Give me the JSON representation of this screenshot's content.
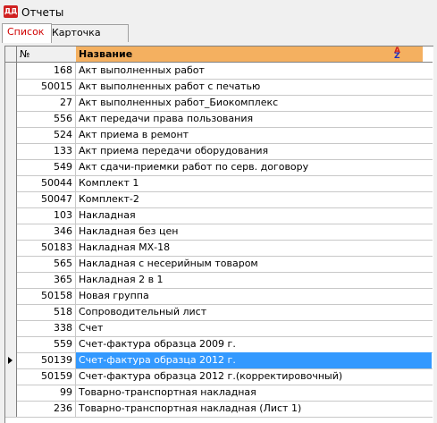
{
  "window": {
    "title": "Отчеты",
    "icon": "app-logo-icon"
  },
  "tabs": [
    {
      "label": "Список",
      "active": true
    },
    {
      "label": "Карточка",
      "active": false
    }
  ],
  "table": {
    "columns": {
      "number": "№",
      "name": "Название"
    },
    "sort_icon": "sort-az-icon",
    "rows": [
      {
        "number": "168",
        "name": "Акт выполненных работ"
      },
      {
        "number": "50015",
        "name": "Акт выполненных работ с печатью"
      },
      {
        "number": "27",
        "name": "Акт выполненных работ_Биокомплекс"
      },
      {
        "number": "556",
        "name": "Акт передачи права пользования"
      },
      {
        "number": "524",
        "name": "Акт приема в ремонт"
      },
      {
        "number": "133",
        "name": "Акт приема передачи оборудования"
      },
      {
        "number": "549",
        "name": "Акт сдачи-приемки работ по серв. договору"
      },
      {
        "number": "50044",
        "name": "Комплект 1"
      },
      {
        "number": "50047",
        "name": "Комплект-2"
      },
      {
        "number": "103",
        "name": "Накладная"
      },
      {
        "number": "346",
        "name": "Накладная без цен"
      },
      {
        "number": "50183",
        "name": "Накладная МХ-18"
      },
      {
        "number": "565",
        "name": "Накладная с несерийным товаром"
      },
      {
        "number": "365",
        "name": "Накладная 2 в 1"
      },
      {
        "number": "50158",
        "name": "Новая группа"
      },
      {
        "number": "518",
        "name": "Сопроводительный лист"
      },
      {
        "number": "338",
        "name": "Счет"
      },
      {
        "number": "559",
        "name": "Счет-фактура образца 2009 г."
      },
      {
        "number": "50139",
        "name": "Счет-фактура образца 2012 г."
      },
      {
        "number": "50159",
        "name": "Счет-фактура образца 2012 г.(корректировочный)"
      },
      {
        "number": "99",
        "name": "Товарно-транспортная накладная"
      },
      {
        "number": "236",
        "name": "Товарно-транспортная накладная (Лист 1)"
      }
    ],
    "selected_index": 18
  }
}
